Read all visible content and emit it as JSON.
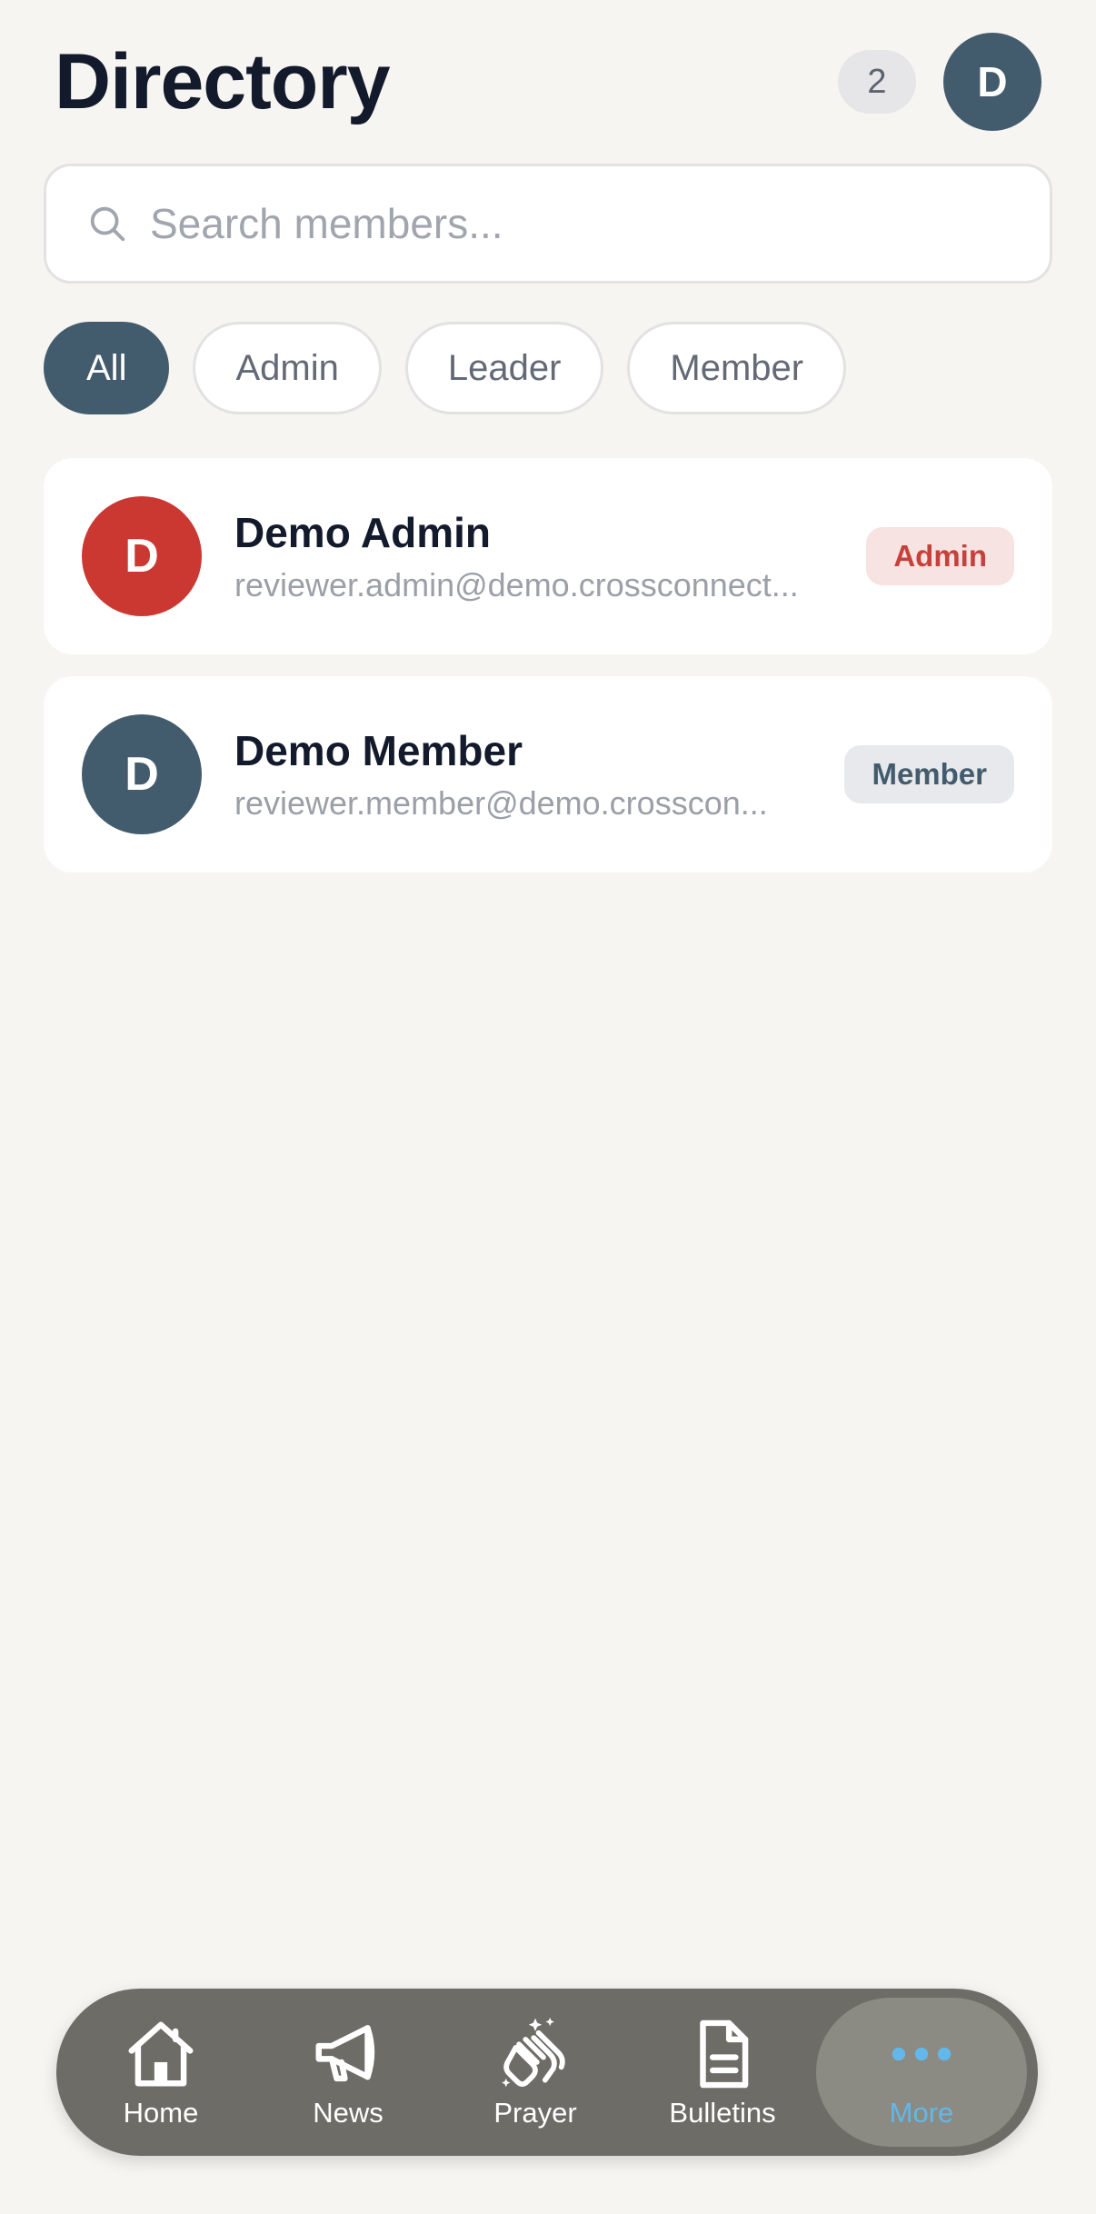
{
  "header": {
    "title": "Directory",
    "count": "2",
    "avatar_initial": "D"
  },
  "search": {
    "placeholder": "Search members...",
    "value": ""
  },
  "filters": [
    {
      "label": "All",
      "active": true
    },
    {
      "label": "Admin",
      "active": false
    },
    {
      "label": "Leader",
      "active": false
    },
    {
      "label": "Member",
      "active": false
    }
  ],
  "members": [
    {
      "initial": "D",
      "name": "Demo Admin",
      "email": "reviewer.admin@demo.crossconnect...",
      "role": "Admin",
      "avatar_color": "#cb3832",
      "badge_bg": "#f6e3e2",
      "badge_color": "#c6413b"
    },
    {
      "initial": "D",
      "name": "Demo Member",
      "email": "reviewer.member@demo.crosscon...",
      "role": "Member",
      "avatar_color": "#435c6d",
      "badge_bg": "#e7e9ec",
      "badge_color": "#435c6d"
    }
  ],
  "nav": {
    "items": [
      {
        "label": "Home",
        "icon": "home-icon"
      },
      {
        "label": "News",
        "icon": "megaphone-icon"
      },
      {
        "label": "Prayer",
        "icon": "praying-hands-icon"
      },
      {
        "label": "Bulletins",
        "icon": "document-icon"
      },
      {
        "label": "More",
        "icon": "more-dots-icon",
        "active": true
      }
    ]
  },
  "colors": {
    "background": "#f6f5f1",
    "accent": "#435c6d",
    "nav_background": "#6e6c66",
    "nav_active": "#62b8ea"
  }
}
